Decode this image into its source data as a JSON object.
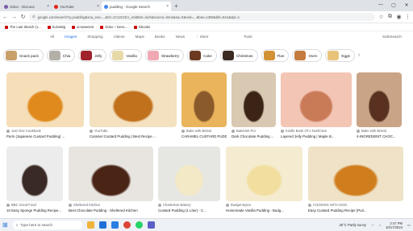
{
  "tabs": [
    {
      "title": "Odoo - Discuss",
      "color": "#7b5ea7",
      "active": false
    },
    {
      "title": "YouTube",
      "color": "#e62117",
      "active": false
    },
    {
      "title": "pudding - Google Search",
      "color": "#4285f4",
      "active": true
    }
  ],
  "address": {
    "url": "google.com/search?q=pudding&sca_esv=...&rlz=1C1GCEA_en&tbm=isch&source=lnms&sa=X&ved=...&biw=1366&bih=641&dpr=1"
  },
  "bookmarks": [
    "The Last Sketch (1...",
    "SolveBig",
    "ai:sweetest",
    "Odoo ~ Desc...",
    "Ebooks"
  ],
  "filters": [
    "All",
    "Images",
    "Shopping",
    "Videos",
    "Maps",
    "Books",
    "News",
    "⋮ More"
  ],
  "tools_label": "Tools",
  "safesearch_label": "SafeSearch",
  "chips": [
    {
      "label": "Snack pack",
      "color": "#c9a06a"
    },
    {
      "label": "Chia",
      "color": "#b3b0a8"
    },
    {
      "label": "Jelly",
      "color": "#a0222a"
    },
    {
      "label": "Vanilla",
      "color": "#e8d9a8"
    },
    {
      "label": "Strawberry",
      "color": "#f0a9b3"
    },
    {
      "label": "Cake",
      "color": "#6b3a21"
    },
    {
      "label": "Christmas",
      "color": "#3a2a22"
    },
    {
      "label": "Flan",
      "color": "#d39135"
    },
    {
      "label": "Oven",
      "color": "#c47b3e"
    },
    {
      "label": "Eggs",
      "color": "#e8c37a"
    }
  ],
  "results": [
    {
      "source": "Just One Cookbook",
      "title": "Purin (Japanese Custard Pudding) ...",
      "c1": "#f5deb8",
      "c2": "#e08a1e"
    },
    {
      "source": "YouTube",
      "title": "Caramel Custard Pudding | Best Recipe ...",
      "c1": "#f3e1c0",
      "c2": "#c1701c"
    },
    {
      "source": "Bake with Bristol",
      "title": "CARAMEL CUSTARD PUDDING ...",
      "c1": "#e9b45c",
      "c2": "#8b5a2b"
    },
    {
      "source": "Bakerish Pro",
      "title": "Dark Chocolate Pudding ...",
      "c1": "#d9c8b2",
      "c2": "#3b2416"
    },
    {
      "source": "Kindle Book Of A Nonfiction",
      "title": "Layered Jelly Pudding | Maple B...",
      "c1": "#f3c5b5",
      "c2": "#c97a57"
    },
    {
      "source": "Bake with Bristol",
      "title": "4-INGREDIENT CHOC...",
      "c1": "#c9a486",
      "c2": "#5a3020"
    },
    {
      "source": "BBC Good Food",
      "title": "10 Easy Sponge Pudding Recipe...",
      "c1": "#ececec",
      "c2": "#3a2a25"
    },
    {
      "source": "Sheltered Kitchen",
      "title": "Best Chocolate Pudding - Sheltered Kitchen",
      "c1": "#e8e5e1",
      "c2": "#4a2415"
    },
    {
      "source": "Charleston Bakery",
      "title": "Custard Pudding (1 Liter) - C...",
      "c1": "#e6e6e2",
      "c2": "#f3e9c7"
    },
    {
      "source": "Budget Bytes",
      "title": "Homemade Vanilla Pudding - Budg...",
      "c1": "#f5ebd0",
      "c2": "#f2dfa0"
    },
    {
      "source": "COOKING WITH DOG",
      "title": "Easy Custard Pudding Recipe (Puri...",
      "c1": "#efe2c6",
      "c2": "#d07d1e"
    }
  ],
  "taskbar": {
    "search_placeholder": "Type here to search",
    "weather": "26°C  Partly sunny",
    "time": "2:47 PM",
    "date": "10/17/2024"
  }
}
